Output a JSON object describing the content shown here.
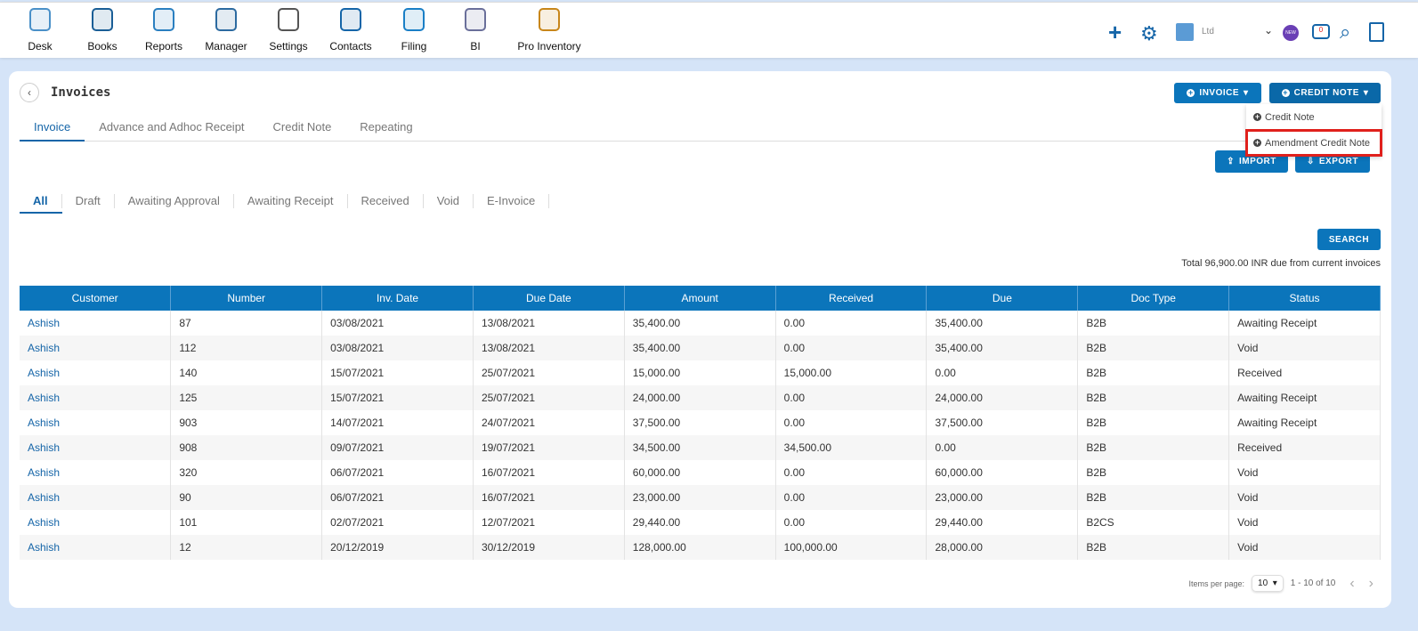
{
  "nav": [
    {
      "label": "Desk",
      "icon": "desk-icon"
    },
    {
      "label": "Books",
      "icon": "books-icon"
    },
    {
      "label": "Reports",
      "icon": "reports-icon"
    },
    {
      "label": "Manager",
      "icon": "manager-icon"
    },
    {
      "label": "Settings",
      "icon": "settings-icon"
    },
    {
      "label": "Contacts",
      "icon": "contacts-icon"
    },
    {
      "label": "Filing",
      "icon": "filing-icon"
    },
    {
      "label": "BI",
      "icon": "bi-icon"
    },
    {
      "label": "Pro Inventory",
      "icon": "pro-inventory-icon"
    }
  ],
  "topright": {
    "company": "Ltd",
    "notif_count": "0",
    "new_badge": "NEW"
  },
  "page": {
    "title": "Invoices",
    "invoice_btn": "INVOICE",
    "credit_btn": "CREDIT NOTE",
    "import_btn": "IMPORT",
    "export_btn": "EXPORT",
    "search_btn": "SEARCH",
    "total": "Total 96,900.00 INR due from current invoices"
  },
  "dropdown": [
    "Credit Note",
    "Amendment Credit Note"
  ],
  "tabs": [
    "Invoice",
    "Advance and Adhoc Receipt",
    "Credit Note",
    "Repeating"
  ],
  "subtabs": [
    "All",
    "Draft",
    "Awaiting Approval",
    "Awaiting Receipt",
    "Received",
    "Void",
    "E-Invoice"
  ],
  "table": {
    "headers": [
      "Customer",
      "Number",
      "Inv. Date",
      "Due Date",
      "Amount",
      "Received",
      "Due",
      "Doc Type",
      "Status"
    ],
    "rows": [
      [
        "Ashish",
        "87",
        "03/08/2021",
        "13/08/2021",
        "35,400.00",
        "0.00",
        "35,400.00",
        "B2B",
        "Awaiting Receipt"
      ],
      [
        "Ashish",
        "112",
        "03/08/2021",
        "13/08/2021",
        "35,400.00",
        "0.00",
        "35,400.00",
        "B2B",
        "Void"
      ],
      [
        "Ashish",
        "140",
        "15/07/2021",
        "25/07/2021",
        "15,000.00",
        "15,000.00",
        "0.00",
        "B2B",
        "Received"
      ],
      [
        "Ashish",
        "125",
        "15/07/2021",
        "25/07/2021",
        "24,000.00",
        "0.00",
        "24,000.00",
        "B2B",
        "Awaiting Receipt"
      ],
      [
        "Ashish",
        "903",
        "14/07/2021",
        "24/07/2021",
        "37,500.00",
        "0.00",
        "37,500.00",
        "B2B",
        "Awaiting Receipt"
      ],
      [
        "Ashish",
        "908",
        "09/07/2021",
        "19/07/2021",
        "34,500.00",
        "34,500.00",
        "0.00",
        "B2B",
        "Received"
      ],
      [
        "Ashish",
        "320",
        "06/07/2021",
        "16/07/2021",
        "60,000.00",
        "0.00",
        "60,000.00",
        "B2B",
        "Void"
      ],
      [
        "Ashish",
        "90",
        "06/07/2021",
        "16/07/2021",
        "23,000.00",
        "0.00",
        "23,000.00",
        "B2B",
        "Void"
      ],
      [
        "Ashish",
        "101",
        "02/07/2021",
        "12/07/2021",
        "29,440.00",
        "0.00",
        "29,440.00",
        "B2CS",
        "Void"
      ],
      [
        "Ashish",
        "12",
        "20/12/2019",
        "30/12/2019",
        "128,000.00",
        "100,000.00",
        "28,000.00",
        "B2B",
        "Void"
      ]
    ]
  },
  "pager": {
    "label": "Items per page:",
    "size": "10",
    "range": "1 - 10 of 10"
  }
}
